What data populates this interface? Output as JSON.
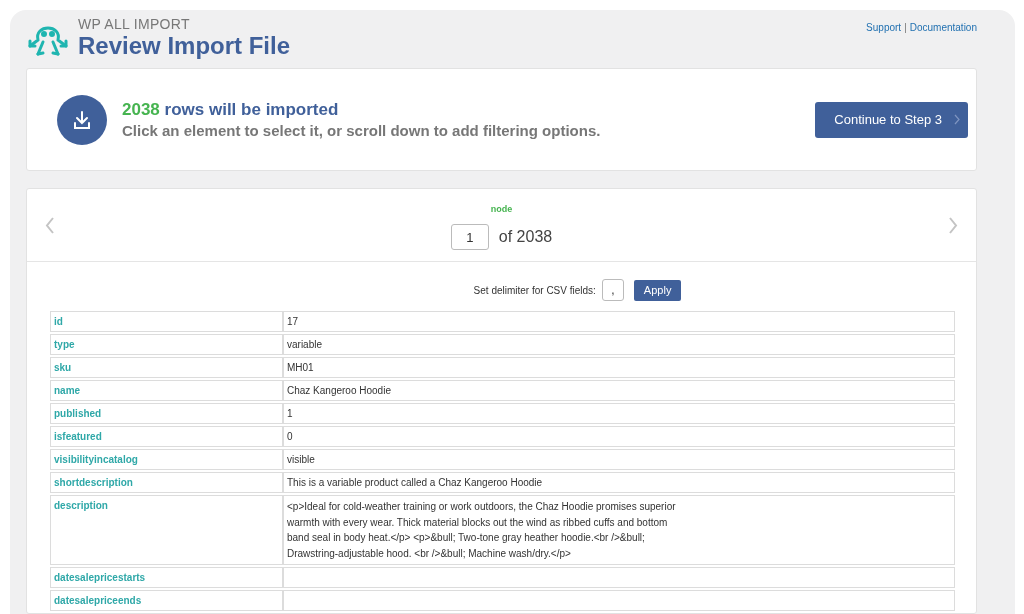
{
  "header": {
    "brand": "WP ALL IMPORT",
    "title": "Review Import File",
    "links": [
      "Support",
      "Documentation"
    ],
    "separator": "|"
  },
  "summary": {
    "count": "2038",
    "headline": "rows will be imported",
    "hint": "Click an element to select it, or scroll down to add filtering options.",
    "button": "Continue to Step 3"
  },
  "navigator": {
    "node": "node",
    "current": "1",
    "total": "of 2038"
  },
  "delimiter": {
    "label": "Set delimiter for CSV fields:",
    "value": ",",
    "button": "Apply"
  },
  "record": [
    {
      "field": "id",
      "value": "17"
    },
    {
      "field": "type",
      "value": "variable"
    },
    {
      "field": "sku",
      "value": "MH01"
    },
    {
      "field": "name",
      "value": "Chaz Kangeroo Hoodie"
    },
    {
      "field": "published",
      "value": "1"
    },
    {
      "field": "isfeatured",
      "value": "0"
    },
    {
      "field": "visibilityincatalog",
      "value": "visible"
    },
    {
      "field": "shortdescription",
      "value": "This is a variable product called a Chaz Kangeroo Hoodie"
    },
    {
      "field": "description",
      "value": "<p>Ideal for cold-weather training or work outdoors, the Chaz Hoodie promises superior warmth with every wear. Thick material blocks out the wind as ribbed cuffs and bottom band seal in body heat.</p> <p>&bull; Two-tone gray heather hoodie.<br />&bull; Drawstring-adjustable hood. <br />&bull; Machine wash/dry.</p>"
    },
    {
      "field": "datesalepricestarts"
    },
    {
      "field": "datesalepriceends"
    }
  ]
}
